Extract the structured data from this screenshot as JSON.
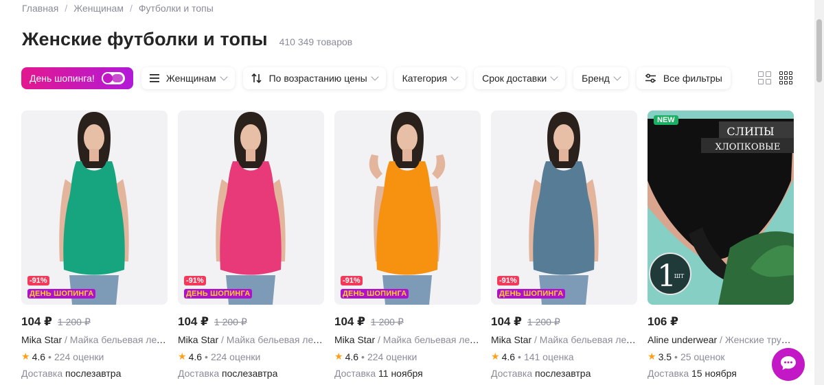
{
  "breadcrumb": [
    "Главная",
    "Женщинам",
    "Футболки и топы"
  ],
  "title": "Женские футболки и топы",
  "count": "410 349 товаров",
  "filters": {
    "promo": "День шопинга!",
    "category_menu": "Женщинам",
    "sort": "По возрастанию цены",
    "category": "Категория",
    "delivery": "Срок доставки",
    "brand": "Бренд",
    "all_filters": "Все фильтры"
  },
  "products": [
    {
      "price": "104 ₽",
      "old_price": "1 200 ₽",
      "brand": "Mika Star",
      "name": "Майка бельевая летняя",
      "rating": "4.6",
      "reviews": "224 оценки",
      "delivery_label": "Доставка",
      "delivery_value": "послезавтра",
      "discount": "-91%",
      "promo_badge": "ДЕНЬ ШОПИНГА",
      "color": "#17a57f"
    },
    {
      "price": "104 ₽",
      "old_price": "1 200 ₽",
      "brand": "Mika Star",
      "name": "Майка бельевая летняя",
      "rating": "4.6",
      "reviews": "224 оценки",
      "delivery_label": "Доставка",
      "delivery_value": "послезавтра",
      "discount": "-91%",
      "promo_badge": "ДЕНЬ ШОПИНГА",
      "color": "#e83a78"
    },
    {
      "price": "104 ₽",
      "old_price": "1 200 ₽",
      "brand": "Mika Star",
      "name": "Майка бельевая летняя",
      "rating": "4.6",
      "reviews": "224 оценки",
      "delivery_label": "Доставка",
      "delivery_value": "11 ноября",
      "discount": "-91%",
      "promo_badge": "ДЕНЬ ШОПИНГА",
      "color": "#f6920f"
    },
    {
      "price": "104 ₽",
      "old_price": "1 200 ₽",
      "brand": "Mika Star",
      "name": "Майка бельевая летняя",
      "rating": "4.6",
      "reviews": "141 оценка",
      "delivery_label": "Доставка",
      "delivery_value": "послезавтра",
      "discount": "-91%",
      "promo_badge": "ДЕНЬ ШОПИНГА",
      "color": "#577c96"
    },
    {
      "price": "106 ₽",
      "old_price": "",
      "brand": "Aline underwear",
      "name": "Женские трусы слипы",
      "rating": "3.5",
      "reviews": "25 оценок",
      "delivery_label": "Доставка",
      "delivery_value": "15 ноября",
      "new_badge": "NEW",
      "image_text_1": "СЛИПЫ",
      "image_text_2": "ХЛОПКОВЫЕ",
      "image_text_3": "1",
      "image_text_4": "ШТ"
    }
  ],
  "colors": {
    "accent": "#c218c5",
    "discount": "#f23b5a",
    "new": "#1aaf63",
    "star": "#ff9f1a"
  },
  "icons": {
    "chat": "chat-bubble-icon",
    "sort": "sort-arrows-icon",
    "menu": "hamburger-icon",
    "filters": "sliders-icon"
  }
}
